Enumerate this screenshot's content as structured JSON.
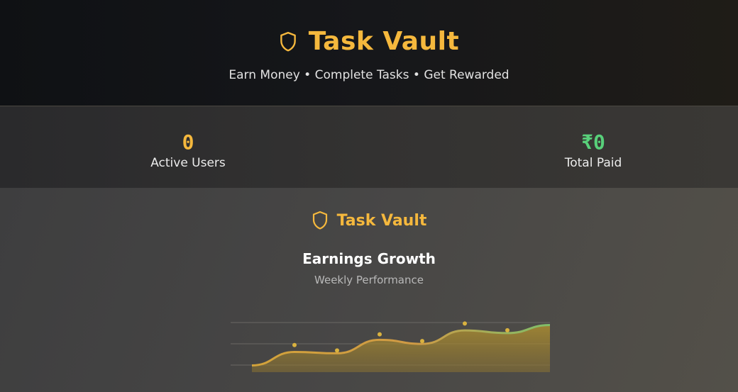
{
  "header": {
    "title": "Task Vault",
    "tagline": "Earn Money • Complete Tasks • Get Rewarded",
    "icon": "shield-icon"
  },
  "stats": {
    "active_users": {
      "value": "0",
      "label": "Active Users"
    },
    "total_paid": {
      "value": "₹0",
      "label": "Total Paid"
    }
  },
  "panel": {
    "brand": "Task Vault",
    "icon": "shield-icon",
    "chart_title": "Earnings Growth",
    "chart_subtitle": "Weekly Performance"
  },
  "colors": {
    "accent": "#f5b83d",
    "success": "#58d07a"
  },
  "chart_data": {
    "type": "area",
    "title": "Earnings Growth",
    "subtitle": "Weekly Performance",
    "points": [
      10,
      30,
      28,
      48,
      42,
      62,
      58,
      70
    ],
    "markers": [
      {
        "x": 1,
        "y": 36
      },
      {
        "x": 2,
        "y": 28
      },
      {
        "x": 3,
        "y": 52
      },
      {
        "x": 4,
        "y": 42
      },
      {
        "x": 5,
        "y": 68
      },
      {
        "x": 6,
        "y": 58
      }
    ],
    "ylim": [
      0,
      80
    ],
    "grid": true
  }
}
